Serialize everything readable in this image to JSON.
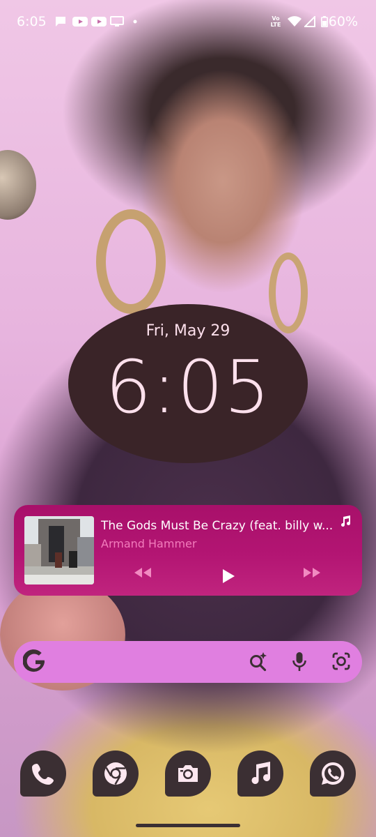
{
  "status_bar": {
    "time": "6:05",
    "icons": [
      "chat-icon",
      "youtube-icon",
      "youtube-icon",
      "cast-icon",
      "dot-icon"
    ],
    "right_icons": [
      "volte-icon",
      "wifi-icon",
      "signal-icon",
      "battery-icon"
    ],
    "volte_label": "Vo LTE",
    "battery": "60%"
  },
  "clock": {
    "date": "Fri, May 29",
    "time": "6:05"
  },
  "media": {
    "title": "The Gods Must Be Crazy (feat. billy w...",
    "artist": "Armand Hammer",
    "controls": [
      "rewind-icon",
      "play-icon",
      "fast-forward-icon"
    ],
    "accent": "#b31573"
  },
  "search": {
    "logo": "G",
    "icons": [
      "ai-search-icon",
      "mic-icon",
      "lens-icon"
    ]
  },
  "dock": {
    "apps": [
      {
        "name": "phone",
        "icon": "phone-icon"
      },
      {
        "name": "chrome",
        "icon": "chrome-icon"
      },
      {
        "name": "camera",
        "icon": "camera-icon"
      },
      {
        "name": "music",
        "icon": "music-icon"
      },
      {
        "name": "whatsapp",
        "icon": "whatsapp-icon"
      }
    ]
  },
  "colors": {
    "clock_bg": "#3a2428",
    "clock_text": "#fde0ec",
    "search_bg": "#e07fe0",
    "dock_bg": "#3b2f33"
  }
}
